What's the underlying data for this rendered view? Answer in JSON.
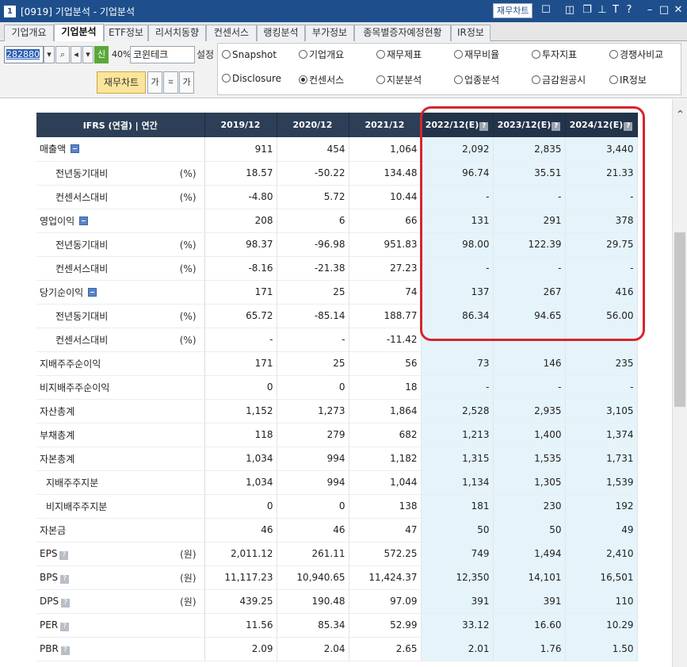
{
  "window": {
    "number": "1",
    "title": "[0919] 기업분석 - 기업분석",
    "chart_button": "재무차트",
    "icons": [
      "chart-icon",
      "split-icon",
      "restore-icon",
      "pin-icon",
      "font-icon",
      "help-icon",
      "minimize-icon",
      "maximize-icon",
      "close-icon"
    ]
  },
  "tabs": [
    "기업개요",
    "기업분석",
    "ETF정보",
    "리서치동향",
    "컨센서스",
    "랭킹분석",
    "부가정보",
    "종목별증자예정현황",
    "IR정보"
  ],
  "active_tab": "기업분석",
  "controls": {
    "stock_code": "282880",
    "new_badge": "신",
    "ratio": "40%",
    "stock_name": "코윈테크",
    "setting_label": "설정",
    "finance_chart_button": "재무차트",
    "font_small_label": "가",
    "font_large_label": "가"
  },
  "radio_options": [
    {
      "label": "Snapshot",
      "selected": false
    },
    {
      "label": "기업개요",
      "selected": false
    },
    {
      "label": "재무제표",
      "selected": false
    },
    {
      "label": "재무비율",
      "selected": false
    },
    {
      "label": "투자지표",
      "selected": false
    },
    {
      "label": "경쟁사비교",
      "selected": false
    },
    {
      "label": "Disclosure",
      "selected": false
    },
    {
      "label": "컨센서스",
      "selected": true
    },
    {
      "label": "지분분석",
      "selected": false
    },
    {
      "label": "업종분석",
      "selected": false
    },
    {
      "label": "금감원공시",
      "selected": false
    },
    {
      "label": "IR정보",
      "selected": false
    }
  ],
  "table": {
    "header_label": "IFRS (연결) | 연간",
    "columns": [
      "2019/12",
      "2020/12",
      "2021/12",
      "2022/12(E)",
      "2023/12(E)",
      "2024/12(E)"
    ],
    "rows": [
      {
        "label": "매출액",
        "unit": "",
        "collapse": true,
        "values": [
          "911",
          "454",
          "1,064",
          "2,092",
          "2,835",
          "3,440"
        ]
      },
      {
        "label": "전년동기대비",
        "unit": "(%)",
        "values": [
          "18.57",
          "-50.22",
          "134.48",
          "96.74",
          "35.51",
          "21.33"
        ]
      },
      {
        "label": "컨센서스대비",
        "unit": "(%)",
        "values": [
          "-4.80",
          "5.72",
          "10.44",
          "-",
          "-",
          "-"
        ]
      },
      {
        "label": "영업이익",
        "unit": "",
        "collapse": true,
        "values": [
          "208",
          "6",
          "66",
          "131",
          "291",
          "378"
        ]
      },
      {
        "label": "전년동기대비",
        "unit": "(%)",
        "values": [
          "98.37",
          "-96.98",
          "951.83",
          "98.00",
          "122.39",
          "29.75"
        ]
      },
      {
        "label": "컨센서스대비",
        "unit": "(%)",
        "values": [
          "-8.16",
          "-21.38",
          "27.23",
          "-",
          "-",
          "-"
        ]
      },
      {
        "label": "당기순이익",
        "unit": "",
        "collapse": true,
        "values": [
          "171",
          "25",
          "74",
          "137",
          "267",
          "416"
        ]
      },
      {
        "label": "전년동기대비",
        "unit": "(%)",
        "values": [
          "65.72",
          "-85.14",
          "188.77",
          "86.34",
          "94.65",
          "56.00"
        ]
      },
      {
        "label": "컨센서스대비",
        "unit": "(%)",
        "values": [
          "-",
          "-",
          "-11.42",
          "",
          "",
          ""
        ]
      },
      {
        "label": "지배주주순이익",
        "unit": "",
        "values": [
          "171",
          "25",
          "56",
          "73",
          "146",
          "235"
        ]
      },
      {
        "label": "비지배주주순이익",
        "unit": "",
        "values": [
          "0",
          "0",
          "18",
          "-",
          "-",
          "-"
        ]
      },
      {
        "label": "자산총계",
        "unit": "",
        "values": [
          "1,152",
          "1,273",
          "1,864",
          "2,528",
          "2,935",
          "3,105"
        ]
      },
      {
        "label": "부채총계",
        "unit": "",
        "values": [
          "118",
          "279",
          "682",
          "1,213",
          "1,400",
          "1,374"
        ]
      },
      {
        "label": "자본총계",
        "unit": "",
        "values": [
          "1,034",
          "994",
          "1,182",
          "1,315",
          "1,535",
          "1,731"
        ]
      },
      {
        "label": "지배주주지분",
        "unit": "",
        "values": [
          "1,034",
          "994",
          "1,044",
          "1,134",
          "1,305",
          "1,539"
        ]
      },
      {
        "label": "비지배주주지분",
        "unit": "",
        "values": [
          "0",
          "0",
          "138",
          "181",
          "230",
          "192"
        ]
      },
      {
        "label": "자본금",
        "unit": "",
        "values": [
          "46",
          "46",
          "47",
          "50",
          "50",
          "49"
        ]
      },
      {
        "label": "EPS",
        "unit": "(원)",
        "help": true,
        "values": [
          "2,011.12",
          "261.11",
          "572.25",
          "749",
          "1,494",
          "2,410"
        ]
      },
      {
        "label": "BPS",
        "unit": "(원)",
        "help": true,
        "values": [
          "11,117.23",
          "10,940.65",
          "11,424.37",
          "12,350",
          "14,101",
          "16,501"
        ]
      },
      {
        "label": "DPS",
        "unit": "(원)",
        "help": true,
        "values": [
          "439.25",
          "190.48",
          "97.09",
          "391",
          "391",
          "110"
        ]
      },
      {
        "label": "PER",
        "unit": "",
        "help": true,
        "values": [
          "11.56",
          "85.34",
          "52.99",
          "33.12",
          "16.60",
          "10.29"
        ]
      },
      {
        "label": "PBR",
        "unit": "",
        "help": true,
        "values": [
          "2.09",
          "2.04",
          "2.65",
          "2.01",
          "1.76",
          "1.50"
        ]
      }
    ]
  },
  "colors": {
    "titlebar": "#1e4f8c",
    "table_header": "#2d3f57",
    "estimate_bg": "#e5f4fb",
    "negative": "#d21f1f",
    "highlight": "#d8242d"
  }
}
